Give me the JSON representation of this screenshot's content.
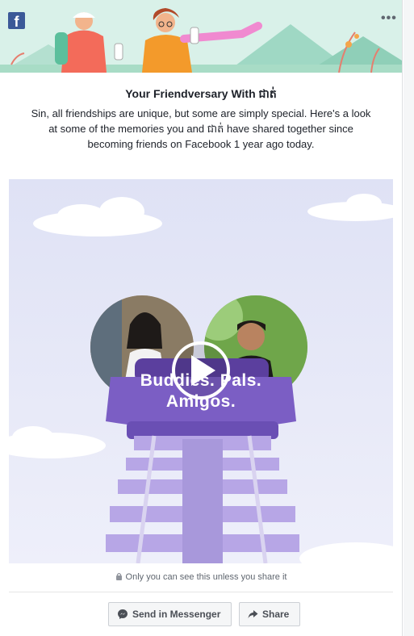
{
  "header": {
    "logo": "f",
    "more_label": "•••"
  },
  "post": {
    "title": "Your Friendversary With ជាត់",
    "description": "Sin, all friendships are unique, but some are simply special. Here's a look at some of the memories you and ជាត់ have shared together since becoming friends on Facebook 1 year ago today."
  },
  "video": {
    "overlay_line1": "Buddies. Pals.",
    "overlay_line2": "Amigos.",
    "play_icon": "play-icon"
  },
  "privacy": {
    "text": "Only you can see this unless you share it",
    "icon": "lock-icon"
  },
  "actions": {
    "messenger_label": "Send in Messenger",
    "share_label": "Share"
  },
  "colors": {
    "brand": "#3b5998",
    "banner_bg": "#d7f0e6",
    "coaster_purple": "#7b5ec4",
    "track_purple": "#b7a6e6"
  }
}
